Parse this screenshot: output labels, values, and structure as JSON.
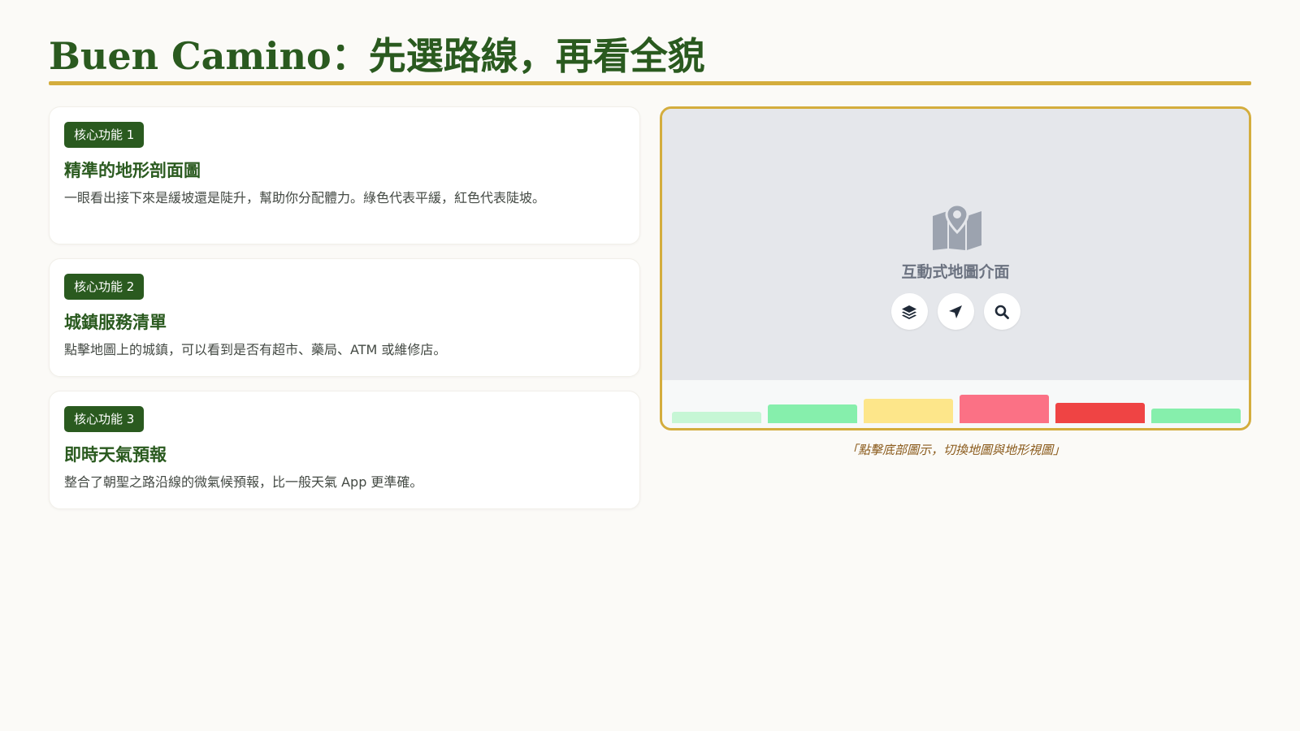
{
  "header": {
    "title": "Buen Camino：先選路線，再看全貌"
  },
  "features": [
    {
      "badge": "核心功能 1",
      "title": "精準的地形剖面圖",
      "description": "一眼看出接下來是緩坡還是陡升，幫助你分配體力。綠色代表平緩，紅色代表陡坡。"
    },
    {
      "badge": "核心功能 2",
      "title": "城鎮服務清單",
      "description": "點擊地圖上的城鎮，可以看到是否有超市、藥局、ATM 或維修店。"
    },
    {
      "badge": "核心功能 3",
      "title": "即時天氣預報",
      "description": "整合了朝聖之路沿線的微氣候預報，比一般天氣 App 更準確。"
    }
  ],
  "map_panel": {
    "label": "互動式地圖介面",
    "map_icon": "map-location-icon",
    "controls": [
      {
        "name": "layers-button",
        "icon": "layers-icon"
      },
      {
        "name": "locate-button",
        "icon": "location-arrow-icon"
      },
      {
        "name": "search-button",
        "icon": "search-icon"
      }
    ],
    "elevation_profile": {
      "segments": [
        {
          "level": 0.4,
          "color": "#c6f6d5"
        },
        {
          "level": 0.65,
          "color": "#86efac"
        },
        {
          "level": 0.85,
          "color": "#fde68a"
        },
        {
          "level": 1.0,
          "color": "#fb7185"
        },
        {
          "level": 0.7,
          "color": "#ef4444"
        },
        {
          "level": 0.5,
          "color": "#86efac"
        }
      ]
    },
    "caption": "「點擊底部圖示，切換地圖與地形視圖」"
  },
  "colors": {
    "brand_green": "#2a5a1f",
    "accent_gold": "#d4ad3d",
    "map_bg": "#e5e7eb",
    "caption": "#8a5a1b"
  }
}
